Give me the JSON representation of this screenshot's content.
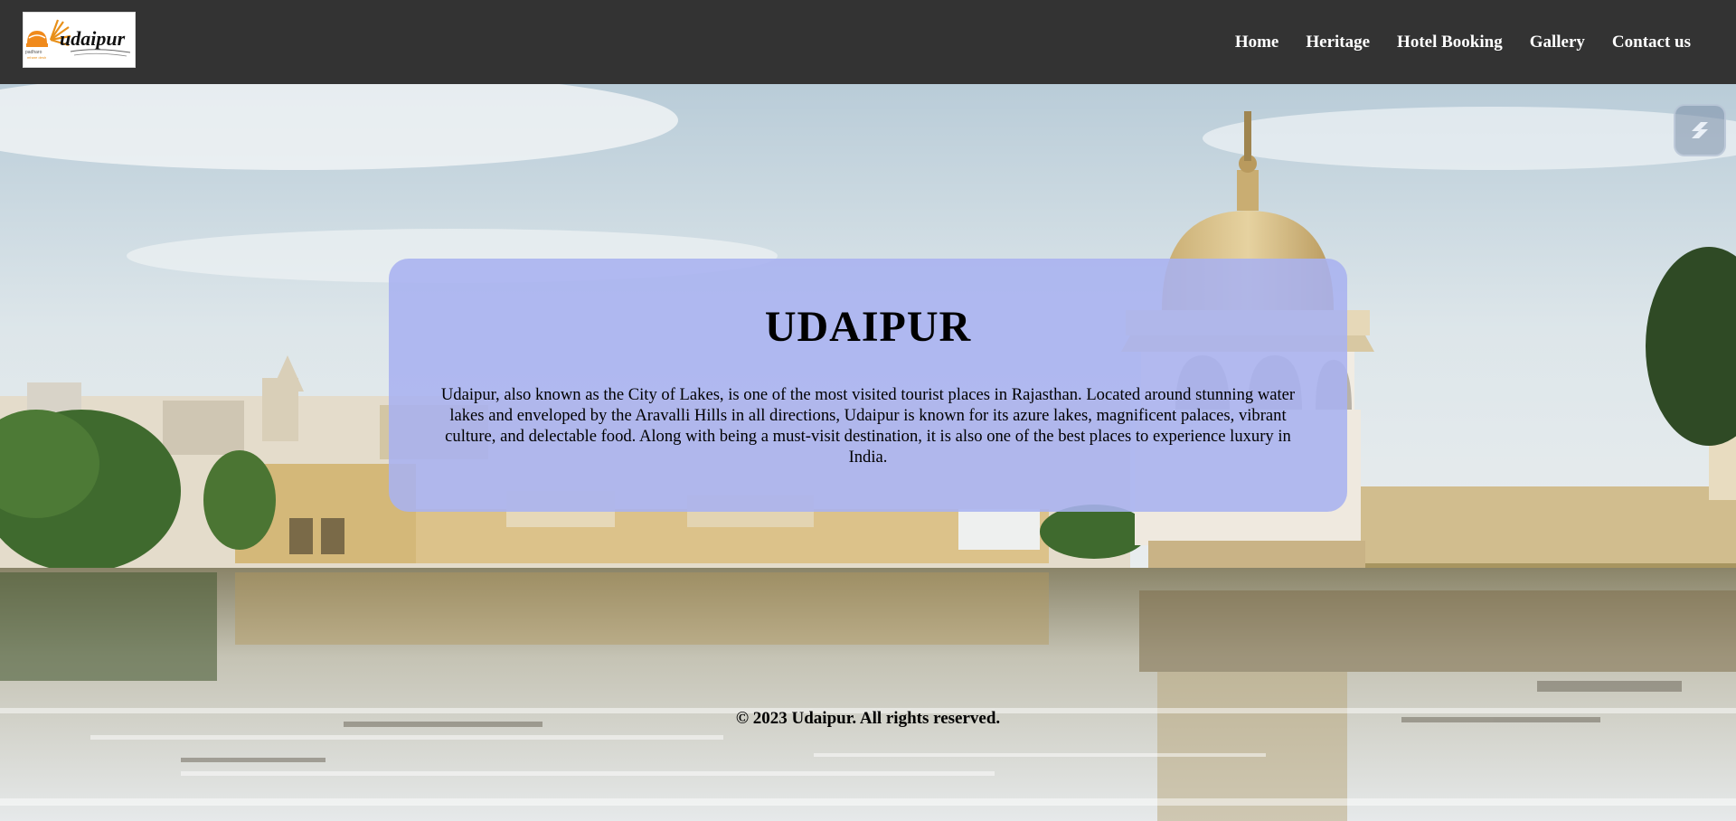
{
  "navbar": {
    "logo_alt": "udaipur",
    "links": [
      {
        "label": "Home"
      },
      {
        "label": "Heritage"
      },
      {
        "label": "Hotel Booking"
      },
      {
        "label": "Gallery"
      },
      {
        "label": "Contact us"
      }
    ]
  },
  "hero": {
    "title": "UDAIPUR",
    "description": "Udaipur, also known as the City of Lakes, is one of the most visited tourist places in Rajasthan. Located around stunning water lakes and enveloped by the Aravalli Hills in all directions, Udaipur is known for its azure lakes, magnificent palaces, vibrant culture, and delectable food. Along with being a must-visit destination, it is also one of the best places to experience luxury in India."
  },
  "footer": {
    "copyright": "© 2023 Udaipur. All rights reserved."
  },
  "colors": {
    "navbar_bg": "#333333",
    "card_bg": "#a8b2f0",
    "nav_text": "#ffffff"
  },
  "icons": {
    "floating_button": "extension-icon"
  }
}
